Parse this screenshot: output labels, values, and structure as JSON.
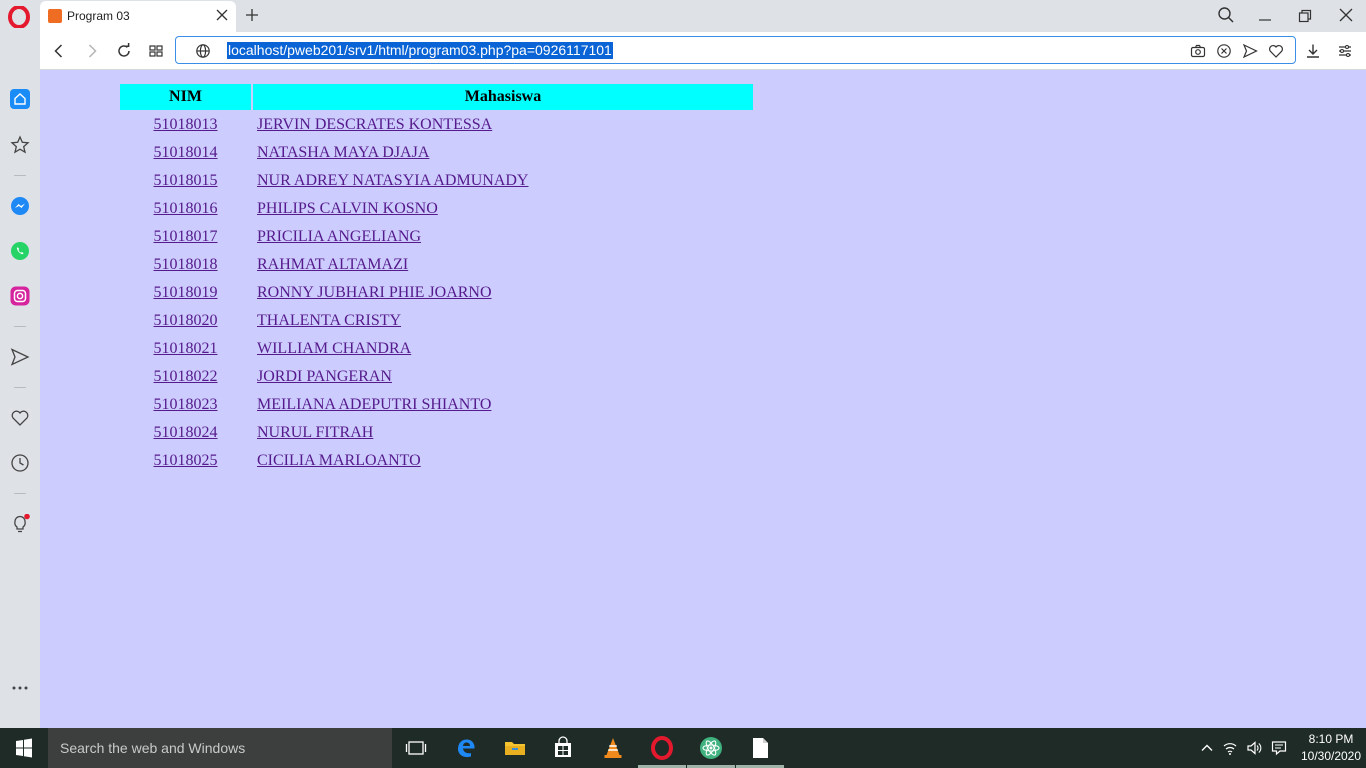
{
  "browser": {
    "tab_title": "Program 03",
    "url": "localhost/pweb201/srv1/html/program03.php?pa=0926117101"
  },
  "table": {
    "headers": {
      "nim": "NIM",
      "mahasiswa": "Mahasiswa"
    },
    "rows": [
      {
        "nim": "51018013",
        "name": "JERVIN DESCRATES KONTESSA"
      },
      {
        "nim": "51018014",
        "name": "NATASHA MAYA DJAJA"
      },
      {
        "nim": "51018015",
        "name": "NUR ADREY NATASYIA ADMUNADY"
      },
      {
        "nim": "51018016",
        "name": "PHILIPS CALVIN KOSNO"
      },
      {
        "nim": "51018017",
        "name": "PRICILIA ANGELIANG"
      },
      {
        "nim": "51018018",
        "name": "RAHMAT ALTAMAZI"
      },
      {
        "nim": "51018019",
        "name": "RONNY JUBHARI PHIE JOARNO"
      },
      {
        "nim": "51018020",
        "name": "THALENTA CRISTY"
      },
      {
        "nim": "51018021",
        "name": "WILLIAM CHANDRA"
      },
      {
        "nim": "51018022",
        "name": "JORDI PANGERAN"
      },
      {
        "nim": "51018023",
        "name": "MEILIANA ADEPUTRI SHIANTO"
      },
      {
        "nim": "51018024",
        "name": "NURUL FITRAH"
      },
      {
        "nim": "51018025",
        "name": "CICILIA MARLOANTO"
      }
    ]
  },
  "taskbar": {
    "search_placeholder": "Search the web and Windows",
    "time": "8:10 PM",
    "date": "10/30/2020"
  },
  "colors": {
    "page_background": "#ccccff",
    "header_background": "#00ffff",
    "link": "#551a8b",
    "url_highlight": "#0a64d6",
    "taskbar": "#1f2b26"
  }
}
